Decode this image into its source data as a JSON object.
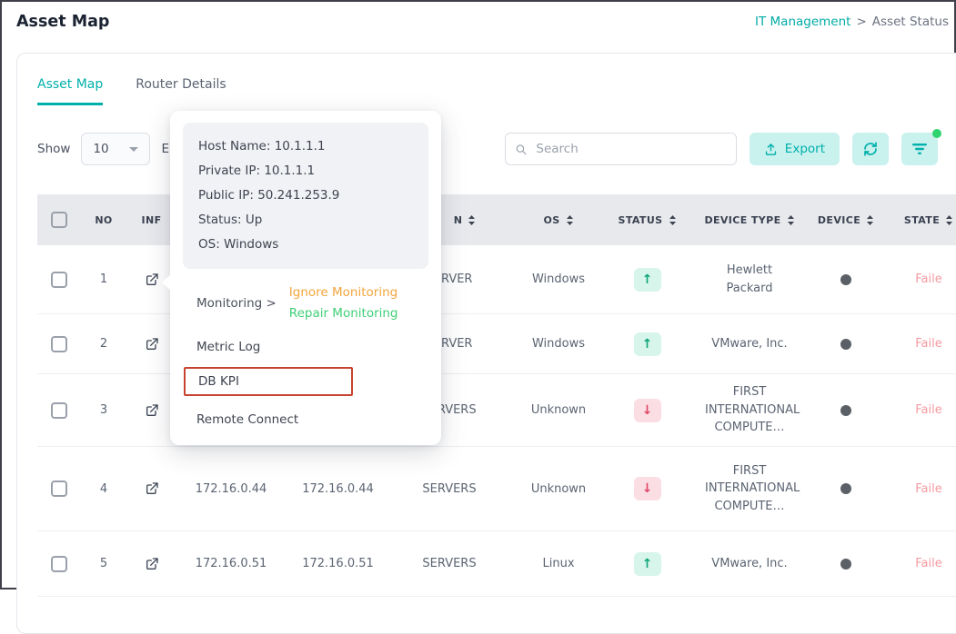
{
  "page": {
    "title": "Asset Map"
  },
  "breadcrumb": {
    "parent": "IT Management",
    "separator": ">",
    "current": "Asset Status"
  },
  "tabs": {
    "asset_map": "Asset Map",
    "router_details": "Router Details"
  },
  "controls": {
    "show_label": "Show",
    "page_size": "10",
    "entries_label": "Entries",
    "search_placeholder": "Search",
    "export_label": "Export"
  },
  "popup": {
    "info": {
      "host_name": "Host Name: 10.1.1.1",
      "private_ip": "Private IP: 10.1.1.1",
      "public_ip": "Public IP: 50.241.253.9",
      "status": "Status: Up",
      "os": "OS: Windows"
    },
    "menu": {
      "monitoring": "Monitoring >",
      "ignore_monitoring": "Ignore Monitoring",
      "repair_monitoring": "Repair Monitoring",
      "metric_log": "Metric Log",
      "db_kpi": "DB KPI",
      "remote_connect": "Remote Connect"
    }
  },
  "table": {
    "headers": {
      "no": "NO",
      "info": "INF",
      "col_n": "N",
      "os": "OS",
      "status": "STATUS",
      "device_type": "DEVICE TYPE",
      "device": "DEVICE",
      "state": "STATE"
    },
    "rows": [
      {
        "no": "1",
        "ip1": "",
        "ip2": "",
        "type": "SERVER",
        "os": "Windows",
        "arrow": "↑",
        "pill_class": "pill up",
        "device_type": "Hewlett Packard",
        "state": "Faile"
      },
      {
        "no": "2",
        "ip1": "",
        "ip2": "",
        "type": "SERVER",
        "os": "Windows",
        "arrow": "↑",
        "pill_class": "pill up",
        "device_type": "VMware, Inc.",
        "state": "Faile"
      },
      {
        "no": "3",
        "ip1": "",
        "ip2": "",
        "type": "SERVERS",
        "os": "Unknown",
        "arrow": "↓",
        "pill_class": "pill down",
        "device_type": "FIRST INTERNATIONAL COMPUTE…",
        "state": "Faile"
      },
      {
        "no": "4",
        "ip1": "172.16.0.44",
        "ip2": "172.16.0.44",
        "type": "SERVERS",
        "os": "Unknown",
        "arrow": "↓",
        "pill_class": "pill down",
        "device_type": "FIRST INTERNATIONAL COMPUTE…",
        "state": "Faile"
      },
      {
        "no": "5",
        "ip1": "172.16.0.51",
        "ip2": "172.16.0.51",
        "type": "SERVERS",
        "os": "Linux",
        "arrow": "↑",
        "pill_class": "pill up",
        "device_type": "VMware, Inc.",
        "state": "Faile"
      }
    ]
  },
  "colors": {
    "accent_teal": "#00b0ab",
    "highlight_red": "#c64330",
    "menu_orange": "#f2a53c",
    "menu_green": "#3fcf77",
    "status_up": "#10a57a",
    "status_down": "#e0486a",
    "state_failed": "#f59aa0"
  }
}
